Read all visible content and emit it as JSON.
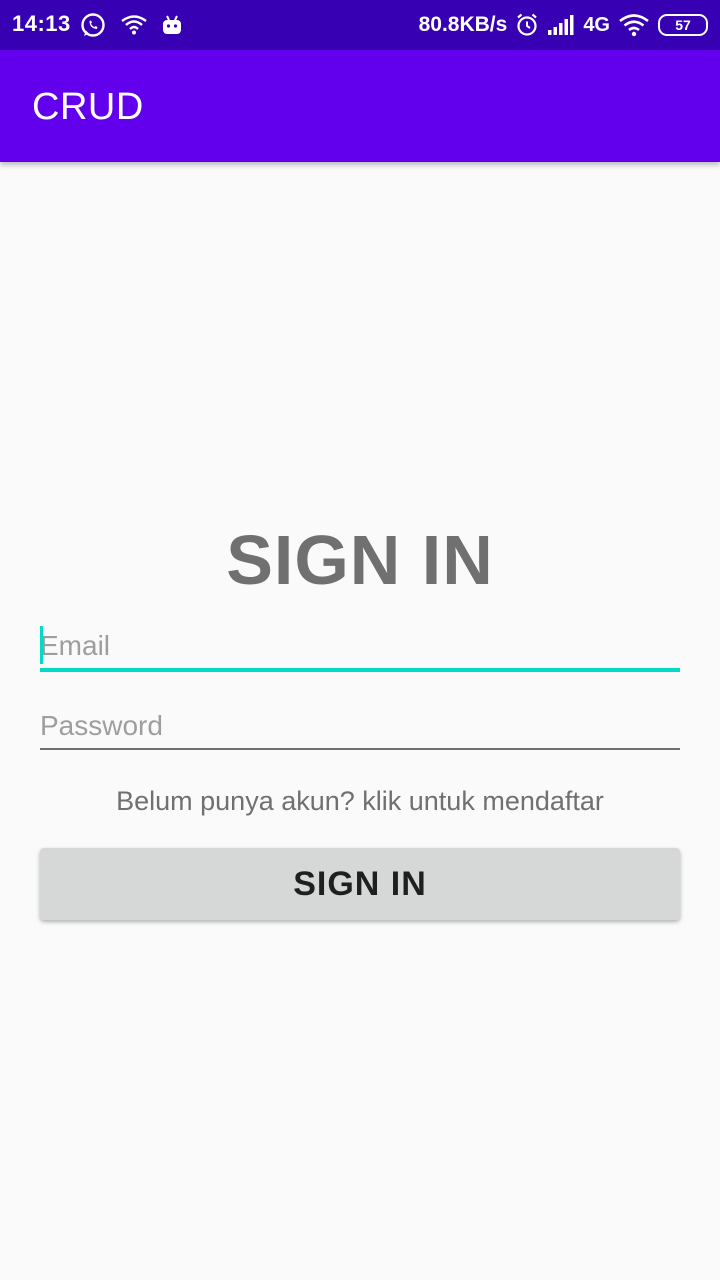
{
  "status_bar": {
    "time": "14:13",
    "net_speed": "80.8KB/s",
    "network_type": "4G",
    "battery": "57",
    "icons_left": [
      "whatsapp-icon",
      "wifi-hotspot-icon",
      "android-icon"
    ],
    "icons_right": [
      "alarm-icon",
      "signal-icon",
      "wifi-icon",
      "battery-icon"
    ]
  },
  "app_bar": {
    "title": "CRUD",
    "color": "#6200ee"
  },
  "form": {
    "heading": "SIGN IN",
    "email": {
      "value": "",
      "placeholder": "Email"
    },
    "password": {
      "value": "",
      "placeholder": "Password"
    },
    "register_link": "Belum punya akun? klik untuk mendaftar",
    "submit_label": "SIGN IN"
  },
  "colors": {
    "status_bar": "#3700b3",
    "accent": "#03dac5",
    "background": "#fafafa"
  }
}
